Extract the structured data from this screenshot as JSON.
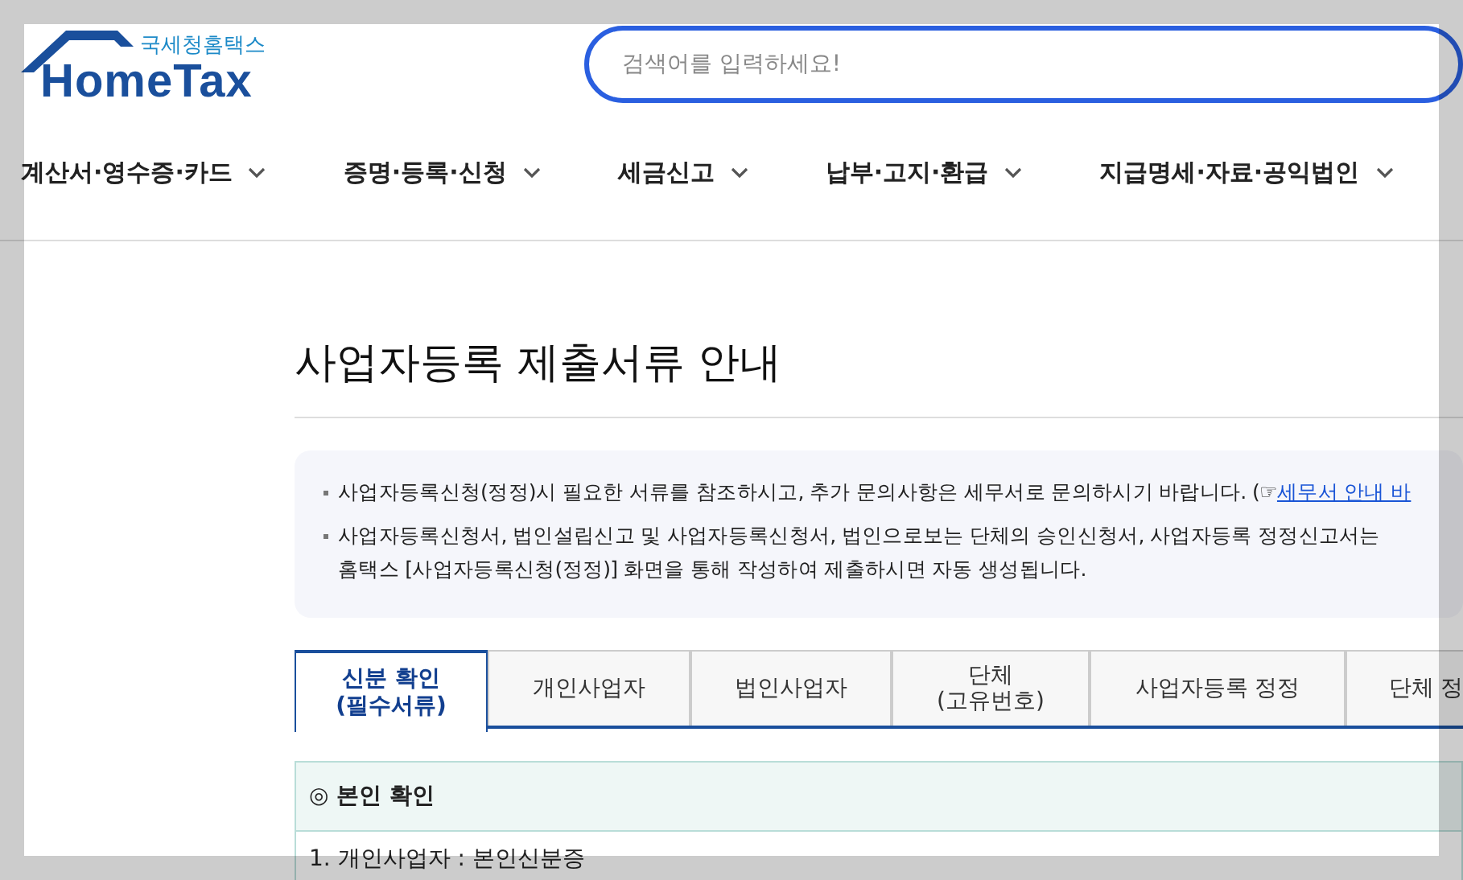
{
  "logo": {
    "subtitle": "국세청홈택스",
    "name": "HomeTax"
  },
  "search": {
    "placeholder": "검색어를 입력하세요!"
  },
  "nav": [
    {
      "label": "계산서·영수증·카드"
    },
    {
      "label": "증명·등록·신청"
    },
    {
      "label": "세금신고"
    },
    {
      "label": "납부·고지·환급"
    },
    {
      "label": "지급명세·자료·공익법인"
    }
  ],
  "title": "사업자등록 제출서류 안내",
  "notices": [
    {
      "text": "사업자등록신청(정정)시 필요한 서류를 참조하시고, 추가 문의사항은 세무서로 문의하시기 바랍니다. (☞",
      "link": "세무서 안내 바"
    },
    {
      "text": "사업자등록신청서, 법인설립신고 및 사업자등록신청서, 법인으로보는 단체의 승인신청서, 사업자등록 정정신고서는 홈택스 [사업자등록신청(정정)] 화면을 통해 작성하여 제출하시면 자동 생성됩니다."
    }
  ],
  "tabs": [
    {
      "label": "신분 확인\n(필수서류)",
      "selected": true
    },
    {
      "label": "개인사업자",
      "selected": false
    },
    {
      "label": "법인사업자",
      "selected": false
    },
    {
      "label": "단체\n(고유번호)",
      "selected": false
    },
    {
      "label": "사업자등록 정정",
      "selected": false
    },
    {
      "label": "단체 정",
      "selected": false
    }
  ],
  "section": {
    "heading": "◎ 본인 확인",
    "rows": [
      "1. 개인사업자 : 본인신분증"
    ]
  }
}
